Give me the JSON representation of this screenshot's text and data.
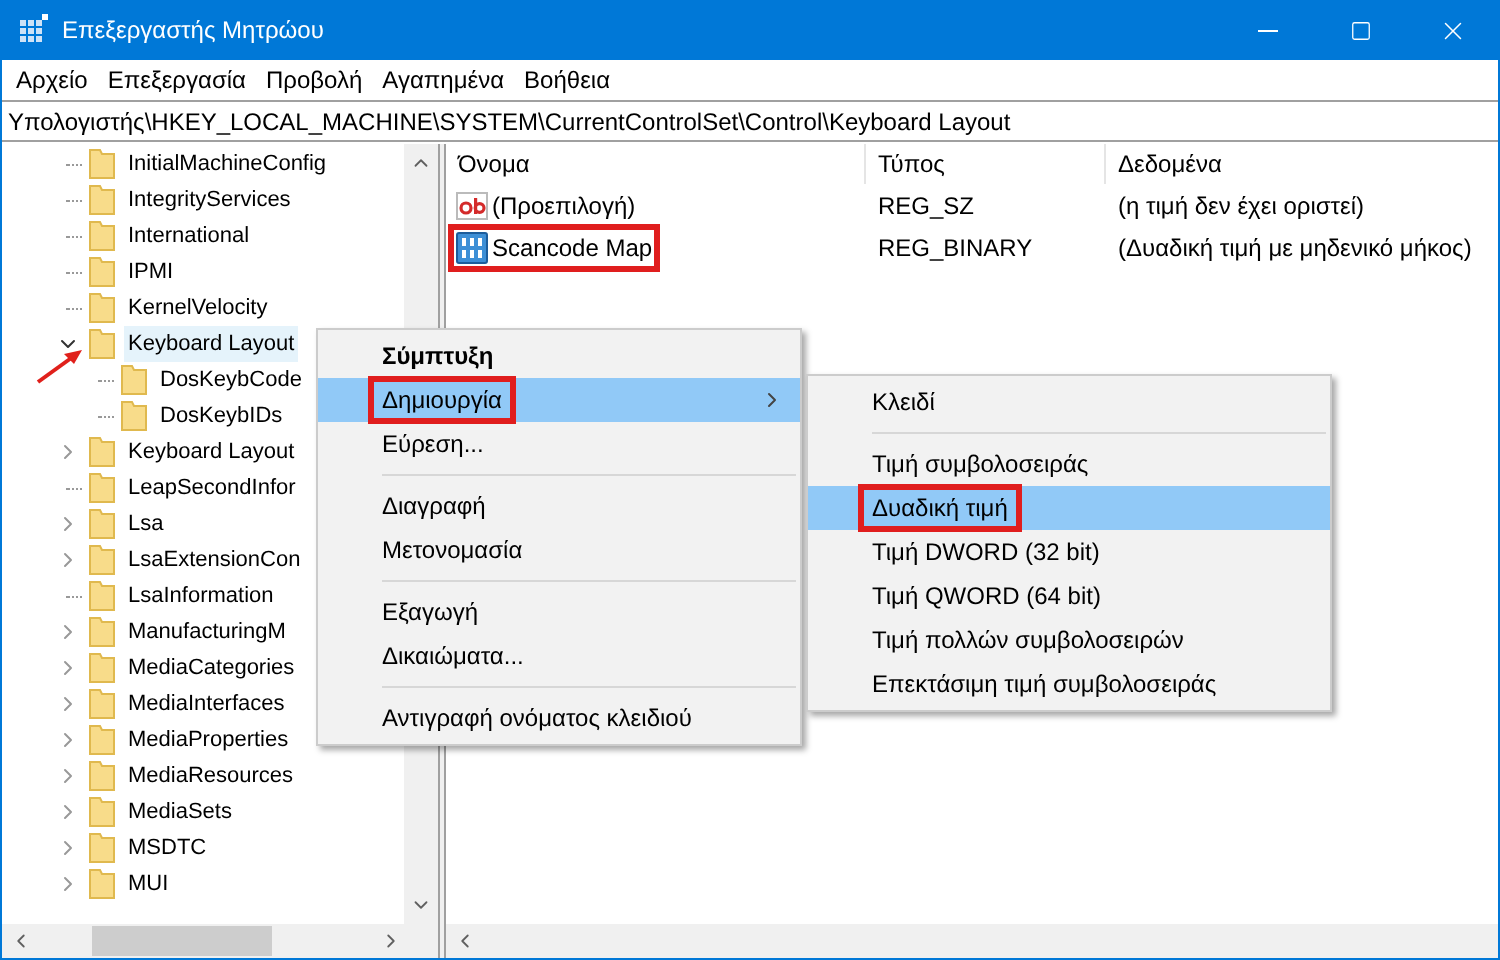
{
  "window": {
    "title": "Επεξεργαστής Μητρώου"
  },
  "menu_bar": [
    "Αρχείο",
    "Επεξεργασία",
    "Προβολή",
    "Αγαπημένα",
    "Βοήθεια"
  ],
  "address": "Υπολογιστής\\HKEY_LOCAL_MACHINE\\SYSTEM\\CurrentControlSet\\Control\\Keyboard Layout",
  "tree": [
    {
      "label": "InitialMachineConfig",
      "has_children": false
    },
    {
      "label": "IntegrityServices",
      "has_children": false
    },
    {
      "label": "International",
      "has_children": false
    },
    {
      "label": "IPMI",
      "has_children": false
    },
    {
      "label": "KernelVelocity",
      "has_children": false
    },
    {
      "label": "Keyboard Layout",
      "has_children": true,
      "expanded": true,
      "selected": true,
      "pointed": true,
      "children": [
        {
          "label": "DosKeybCode",
          "has_children": false
        },
        {
          "label": "DosKeybIDs",
          "has_children": false
        }
      ]
    },
    {
      "label": "Keyboard Layout",
      "has_children": true,
      "expanded": false
    },
    {
      "label": "LeapSecondInfor",
      "has_children": false
    },
    {
      "label": "Lsa",
      "has_children": true,
      "expanded": false
    },
    {
      "label": "LsaExtensionCon",
      "has_children": true,
      "expanded": false
    },
    {
      "label": "LsaInformation",
      "has_children": false
    },
    {
      "label": "ManufacturingM",
      "has_children": true,
      "expanded": false
    },
    {
      "label": "MediaCategories",
      "has_children": true,
      "expanded": false
    },
    {
      "label": "MediaInterfaces",
      "has_children": true,
      "expanded": false
    },
    {
      "label": "MediaProperties",
      "has_children": true,
      "expanded": false
    },
    {
      "label": "MediaResources",
      "has_children": true,
      "expanded": false
    },
    {
      "label": "MediaSets",
      "has_children": true,
      "expanded": false
    },
    {
      "label": "MSDTC",
      "has_children": true,
      "expanded": false
    },
    {
      "label": "MUI",
      "has_children": true,
      "expanded": false
    }
  ],
  "table": {
    "columns": [
      "Όνομα",
      "Τύπος",
      "Δεδομένα"
    ],
    "rows": [
      {
        "kind": "string",
        "name": "(Προεπιλογή)",
        "type": "REG_SZ",
        "data": "(η τιμή δεν έχει οριστεί)",
        "outlined": false
      },
      {
        "kind": "binary",
        "name": "Scancode Map",
        "type": "REG_BINARY",
        "data": "(Δυαδική τιμή με μηδενικό μήκος)",
        "outlined": true
      }
    ]
  },
  "context_menu": [
    {
      "kind": "item",
      "label": "Σύμπτυξη",
      "bold": true,
      "selected": false,
      "outlined": false
    },
    {
      "kind": "item",
      "label": "Δημιουργία",
      "submenu": true,
      "selected": true,
      "outlined": true
    },
    {
      "kind": "item",
      "label": "Εύρεση...",
      "selected": false,
      "outlined": false
    },
    {
      "kind": "separator"
    },
    {
      "kind": "item",
      "label": "Διαγραφή",
      "selected": false,
      "outlined": false
    },
    {
      "kind": "item",
      "label": "Μετονομασία",
      "selected": false,
      "outlined": false
    },
    {
      "kind": "separator"
    },
    {
      "kind": "item",
      "label": "Εξαγωγή",
      "selected": false,
      "outlined": false
    },
    {
      "kind": "item",
      "label": "Δικαιώματα...",
      "selected": false,
      "outlined": false
    },
    {
      "kind": "separator"
    },
    {
      "kind": "item",
      "label": "Αντιγραφή ονόματος κλειδιού",
      "selected": false,
      "outlined": false
    }
  ],
  "submenu": [
    {
      "kind": "item",
      "label": "Κλειδί",
      "selected": false,
      "outlined": false
    },
    {
      "kind": "separator"
    },
    {
      "kind": "item",
      "label": "Τιμή συμβολοσειράς",
      "selected": false,
      "outlined": false
    },
    {
      "kind": "item",
      "label": "Δυαδική τιμή",
      "selected": true,
      "outlined": true
    },
    {
      "kind": "item",
      "label": "Τιμή DWORD (32 bit)",
      "selected": false,
      "outlined": false
    },
    {
      "kind": "item",
      "label": "Τιμή QWORD (64 bit)",
      "selected": false,
      "outlined": false
    },
    {
      "kind": "item",
      "label": "Τιμή πολλών συμβολοσειρών",
      "selected": false,
      "outlined": false
    },
    {
      "kind": "item",
      "label": "Επεκτάσιμη τιμή συμβολοσειράς",
      "selected": false,
      "outlined": false
    }
  ]
}
